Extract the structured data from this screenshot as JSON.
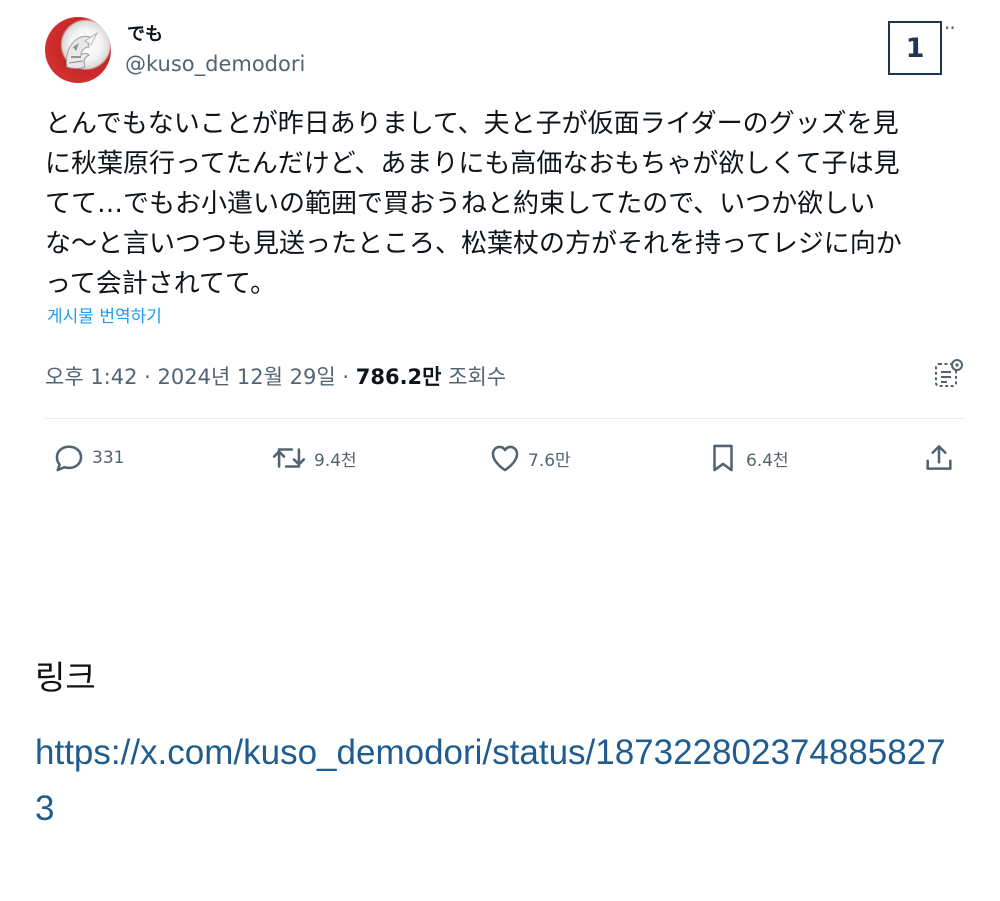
{
  "tweet": {
    "author": {
      "display_name": "でも",
      "handle": "@kuso_demodori"
    },
    "badge_number": "1",
    "text_lines": [
      "とんでもないことが昨日ありまして、夫と子が仮面ライダーのグッズを見",
      "に秋葉原行ってたんだけど、あまりにも高価なおもちゃが欲しくて子は見",
      "てて…でもお小遣いの範囲で買おうねと約束してたので、いつか欲しい",
      "な〜と言いつつも見送ったところ、松葉杖の方がそれを持ってレジに向か",
      "って会計されてて。"
    ],
    "translate_label": "게시물 번역하기",
    "timestamp": "오후 1:42 · 2024년 12월 29일 · ",
    "views_count": "786.2만",
    "views_label": " 조회수",
    "actions": {
      "reply": {
        "icon": "reply-icon",
        "count": "331"
      },
      "retweet": {
        "icon": "retweet-icon",
        "count": "9.4천"
      },
      "like": {
        "icon": "heart-icon",
        "count": "7.6만"
      },
      "bookmark": {
        "icon": "bookmark-icon",
        "count": "6.4천"
      },
      "share": {
        "icon": "share-icon"
      }
    }
  },
  "link_section": {
    "heading": "링크",
    "url": "https://x.com/kuso_demodori/status/1873228023748858273"
  },
  "colors": {
    "secondary_text": "#536471",
    "translate_blue": "#1d9bf0",
    "link_blue": "#1f5c8f",
    "badge_border": "#1d3557"
  }
}
